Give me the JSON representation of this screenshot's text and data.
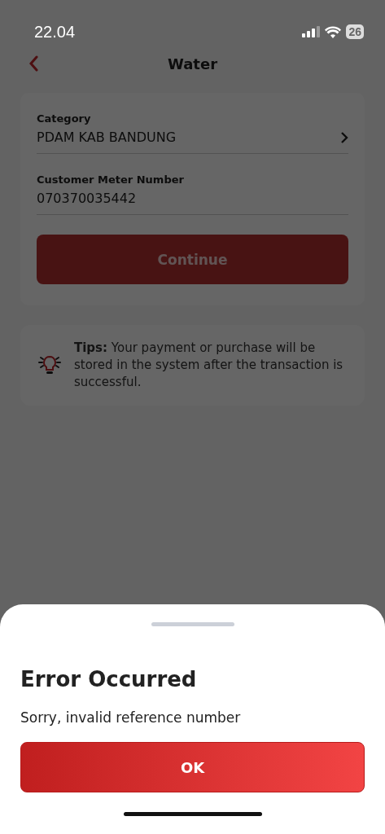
{
  "status_bar": {
    "time": "22.04",
    "battery": "26"
  },
  "header": {
    "title": "Water"
  },
  "form": {
    "fields": [
      {
        "label": "Category",
        "value": "PDAM KAB BANDUNG",
        "kind": "select"
      },
      {
        "label": "Customer Meter Number",
        "value": "070370035442",
        "kind": "input"
      }
    ],
    "button": {
      "label": "Continue",
      "disabled": true
    }
  },
  "tips": {
    "text": "**Tips:**  Your payment or purchase will be stored in the system after the transaction is successful."
  },
  "dialog": {
    "title": "Error Occurred",
    "message": "Sorry, invalid reference number",
    "button": "OK"
  }
}
